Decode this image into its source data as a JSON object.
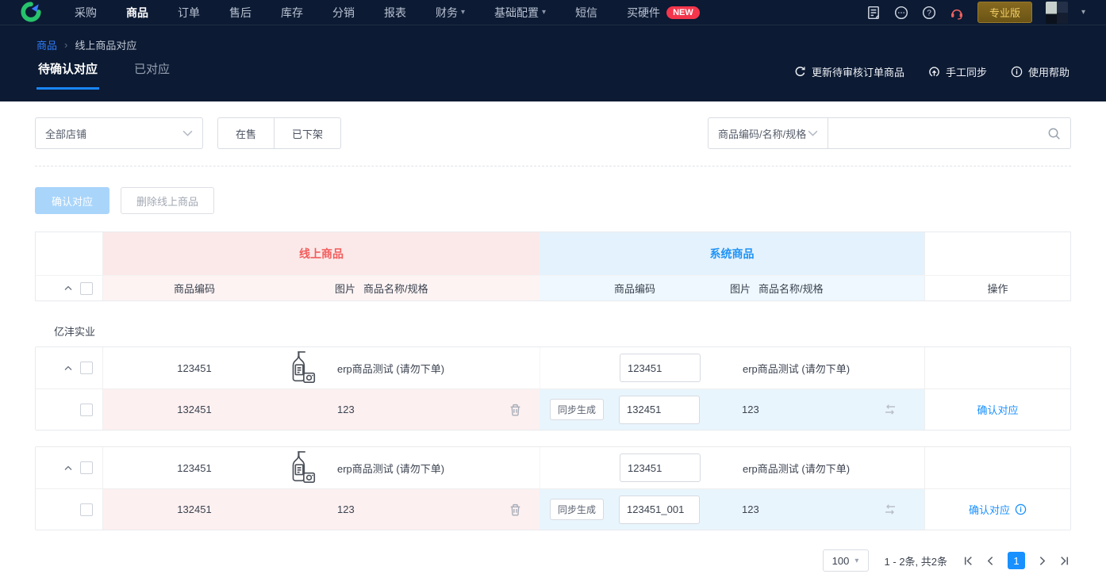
{
  "nav": {
    "items": [
      {
        "label": "采购"
      },
      {
        "label": "商品",
        "active": true
      },
      {
        "label": "订单"
      },
      {
        "label": "售后"
      },
      {
        "label": "库存"
      },
      {
        "label": "分销"
      },
      {
        "label": "报表"
      },
      {
        "label": "财务",
        "caret": true
      },
      {
        "label": "基础配置",
        "caret": true
      },
      {
        "label": "短信"
      },
      {
        "label": "买硬件",
        "badge": "NEW"
      }
    ],
    "new_badge": "NEW",
    "version_button": "专业版"
  },
  "icons": {
    "caret_down": "▾",
    "breadcrumb_separator": "›"
  },
  "breadcrumb": {
    "section": "商品",
    "current": "线上商品对应"
  },
  "tabs": {
    "pending": "待确认对应",
    "matched": "已对应"
  },
  "toolbar": {
    "refresh_label": "更新待审核订单商品",
    "manual_sync_label": "手工同步",
    "help_label": "使用帮助"
  },
  "filters": {
    "shop_selected": "全部店铺",
    "on_sale": "在售",
    "off_shelf": "已下架",
    "search_field_selected": "商品编码/名称/规格",
    "search_value": ""
  },
  "actions": {
    "confirm": "确认对应",
    "delete_online": "删除线上商品"
  },
  "table": {
    "online_group": "线上商品",
    "system_group": "系统商品",
    "col_code": "商品编码",
    "col_image": "图片",
    "col_name": "商品名称/规格",
    "col_operation": "操作"
  },
  "shop_name": "亿沣实业",
  "groups": [
    {
      "parent": {
        "online_code": "123451",
        "online_name": "erp商品测试 (请勿下单)",
        "system_code": "123451",
        "system_name": "erp商品测试 (请勿下单)"
      },
      "sku": {
        "online_code": "132451",
        "online_name": "123",
        "sync_button": "同步生成",
        "system_code": "132451",
        "system_name": "123",
        "action": "确认对应"
      }
    },
    {
      "parent": {
        "online_code": "123451",
        "online_name": "erp商品测试 (请勿下单)",
        "system_code": "123451",
        "system_name": "erp商品测试 (请勿下单)"
      },
      "sku": {
        "online_code": "132451",
        "online_name": "123",
        "sync_button": "同步生成",
        "system_code": "123451_001",
        "system_name": "123",
        "action": "确认对应"
      }
    }
  ],
  "pagination": {
    "page_size": "100",
    "summary": "1 - 2条, 共2条",
    "page": "1"
  }
}
